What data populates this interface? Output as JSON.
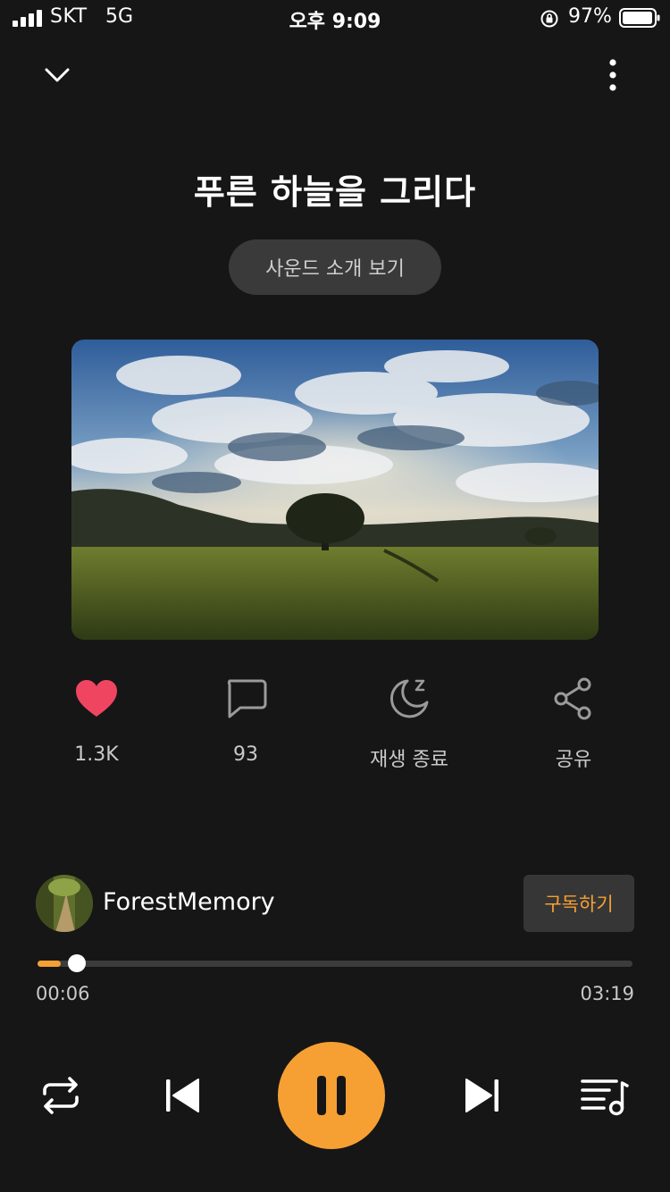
{
  "status_bar": {
    "carrier": "SKT",
    "network": "5G",
    "time": "오후 9:09",
    "battery": "97%",
    "battery_level": 0.97
  },
  "title": "푸른 하늘을 그리다",
  "intro_button": "사운드 소개 보기",
  "actions": {
    "like": {
      "label": "1.3K",
      "icon": "heart-icon"
    },
    "comment": {
      "label": "93",
      "icon": "comment-icon"
    },
    "sleep_timer": {
      "label": "재생 종료",
      "icon": "moon-icon"
    },
    "share": {
      "label": "공유",
      "icon": "share-icon"
    }
  },
  "creator": {
    "name": "ForestMemory",
    "subscribe": "구독하기"
  },
  "player": {
    "current_time": "00:06",
    "total_time": "03:19",
    "progress": 0.03
  },
  "colors": {
    "accent": "#f6a033",
    "background": "#161616",
    "like": "#ef4560"
  }
}
